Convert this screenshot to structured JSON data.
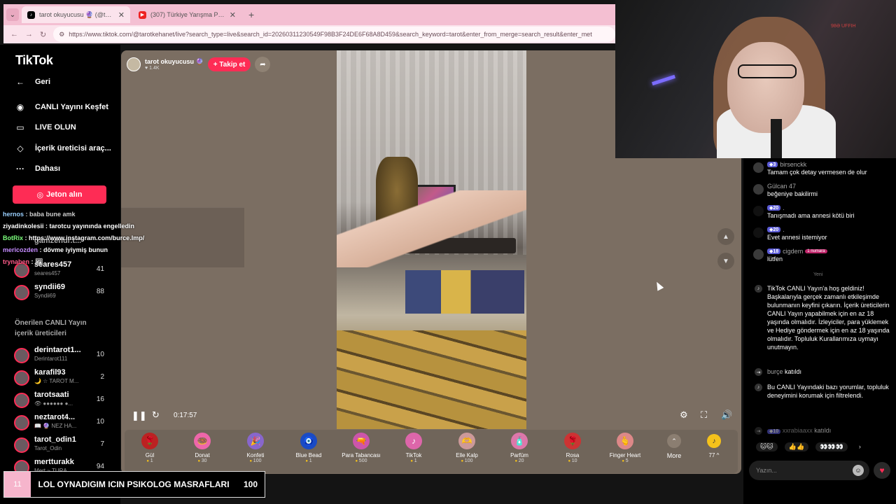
{
  "browser": {
    "tabs": [
      {
        "title": "tarot okuyucusu 🔮 (@tarot",
        "active": true
      },
      {
        "title": "(307) Türkiye Yarışma Programı",
        "active": false
      }
    ],
    "url": "https://www.tiktok.com/@tarotkehanet/live?search_type=live&search_id=20260311230549F98B3F24DE6F68A8D459&search_keyword=tarot&enter_from_merge=search_result&enter_met"
  },
  "sidebar": {
    "logo": "TikTok",
    "back_label": "Geri",
    "nav": [
      {
        "label": "CANLI Yayını Keşfet",
        "icon": "live-discover-icon"
      },
      {
        "label": "LIVE OLUN",
        "icon": "camera-icon"
      },
      {
        "label": "İçerik üreticisi araç...",
        "icon": "creator-tools-icon"
      },
      {
        "label": "Dahası",
        "icon": "more-dots-icon"
      }
    ],
    "jeton_label": "Jeton alın",
    "followed_partial": "gamzenur.t...",
    "followed": [
      {
        "name": "seares457",
        "sub": "seares457",
        "count": "41"
      },
      {
        "name": "syndii69",
        "sub": "Syndii69",
        "count": "88"
      }
    ],
    "suggested_title": "Önerilen CANLI Yayın içerik üreticileri",
    "suggested": [
      {
        "name": "derintarot1...",
        "sub": "Derintarot111",
        "count": "10"
      },
      {
        "name": "karafil93",
        "sub": "🌙 ☆ TAROT M...",
        "count": "2"
      },
      {
        "name": "tarotsaati",
        "sub": "👁 ●●●●●● ●...",
        "count": "16"
      },
      {
        "name": "neztarot4...",
        "sub": "📖 🔮 NEZ HA...",
        "count": "10"
      },
      {
        "name": "tarot_odin1",
        "sub": "Tarot_Odin",
        "count": "7"
      },
      {
        "name": "mertturakk",
        "sub": "Mert ~ TURA...",
        "count": "94"
      }
    ]
  },
  "overlay_chat": [
    {
      "user": "hernos",
      "text": "baba bune amk",
      "color": "#9ad0ff"
    },
    {
      "user": "ziyadinkolesii",
      "text": "tarotcu yayınında engelledin",
      "color": "#ffffff"
    },
    {
      "user": "BotRix",
      "text": "https://www.instagram.com/burce.lmp/",
      "color": "#7cff7c"
    },
    {
      "user": "mericozden",
      "text": "dövme iyiymiş bunun",
      "color": "#c58cff"
    },
    {
      "user": "trynaben",
      "text": "🖼",
      "color": "#ff5c8a"
    }
  ],
  "stream": {
    "streamer_name": "tarot okuyucusu 🔮",
    "likes": "♥ 1.4K",
    "follow_label": "+ Takip et",
    "elapsed": "0:17:57"
  },
  "gifts": [
    {
      "name": "Gül",
      "price": "1",
      "icon": "🌹",
      "bg": "#b22"
    },
    {
      "name": "Donat",
      "price": "30",
      "icon": "🍩",
      "bg": "#e6a"
    },
    {
      "name": "Konfeti",
      "price": "100",
      "icon": "🎉",
      "bg": "#86c"
    },
    {
      "name": "Blue Bead",
      "price": "1",
      "icon": "🧿",
      "bg": "#1a4bc4"
    },
    {
      "name": "Para Tabancası",
      "price": "500",
      "icon": "🔫",
      "bg": "#c5a"
    },
    {
      "name": "TikTok",
      "price": "1",
      "icon": "♪",
      "bg": "#d6a"
    },
    {
      "name": "Elle Kalp",
      "price": "100",
      "icon": "🫶",
      "bg": "#c99"
    },
    {
      "name": "Parfüm",
      "price": "20",
      "icon": "🧴",
      "bg": "#d7a"
    },
    {
      "name": "Rosa",
      "price": "10",
      "icon": "🌹",
      "bg": "#c33"
    },
    {
      "name": "Finger Heart",
      "price": "5",
      "icon": "🫰",
      "bg": "#d88"
    }
  ],
  "gift_more_label": "More",
  "coin_count": "77",
  "chat": {
    "messages": [
      {
        "user": "birsenckk",
        "level": "3",
        "text": "Tamam çok detay vermesen de olur"
      },
      {
        "user": "Gülcan 47",
        "level": "",
        "text": "beğeniye bakilirmi"
      },
      {
        "user": ".",
        "level": "20",
        "text": "Tanışmadı ama annesi kötü biri"
      },
      {
        "user": ".",
        "level": "20",
        "text": "Evet annesi istemiyor"
      },
      {
        "user": "cigdem",
        "level": "18",
        "badge": "1 numara",
        "text": "lütfen"
      }
    ],
    "divider": "Yeni",
    "welcome": "TikTok CANLI Yayın'a hoş geldiniz! Başkalarıyla gerçek zamanlı etkileşimde bulunmanın keyfini çıkarın. İçerik üreticilerin CANLI Yayın yapabilmek için en az 18 yaşında olmalıdır. İzleyiciler, para yüklemek ve Hediye göndermek için en az 18 yaşında olmalıdır. Topluluk Kurallarımıza uymayı unutmayın.",
    "join1_user": "burçe",
    "join1_text": "katıldı",
    "filter_note": "Bu CANLI Yayındaki bazı yorumlar, topluluk deneyimini korumak için filtrelendi.",
    "join2_level": "10",
    "join2_user": "xxrabiaaxx",
    "join2_text": "katıldı",
    "reactions": [
      "🐱🐱",
      "👍👍",
      "👀👀👀"
    ],
    "input_placeholder": "Yazın..."
  },
  "webcam": {
    "label": "98Ə UFFIH"
  },
  "goal": {
    "number": "11",
    "text": "LOL OYNADIGIM ICIN PSIKOLOG MASRAFLARI",
    "count": "100"
  }
}
